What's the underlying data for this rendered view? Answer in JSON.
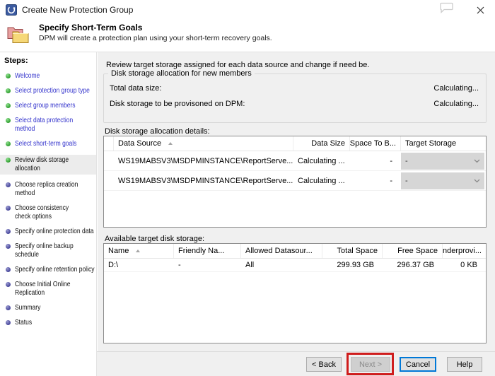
{
  "window": {
    "title": "Create New Protection Group"
  },
  "icons": {
    "titlebar": "dpm-app-icon",
    "feedback": "speech-bubble-icon",
    "close": "close-icon",
    "header": "protection-group-folders-icon",
    "sort": "sort-ascending-icon",
    "dropdown": "chevron-down-icon"
  },
  "header": {
    "title": "Specify Short-Term Goals",
    "subtitle": "DPM will create a protection plan using your short-term recovery goals."
  },
  "sidebar": {
    "heading": "Steps:",
    "steps": [
      {
        "label": "Welcome",
        "status": "done"
      },
      {
        "label": "Select protection group type",
        "status": "done"
      },
      {
        "label": "Select group members",
        "status": "done"
      },
      {
        "label": "Select data protection method",
        "status": "done"
      },
      {
        "label": "Select short-term goals",
        "status": "done"
      },
      {
        "label": "Review disk storage allocation",
        "status": "current"
      },
      {
        "label": "Choose replica creation method",
        "status": "upcoming"
      },
      {
        "label": "Choose consistency check options",
        "status": "upcoming"
      },
      {
        "label": "Specify online protection data",
        "status": "upcoming"
      },
      {
        "label": "Specify online backup schedule",
        "status": "upcoming"
      },
      {
        "label": "Specify online retention policy",
        "status": "upcoming"
      },
      {
        "label": "Choose Initial Online Replication",
        "status": "upcoming"
      },
      {
        "label": "Summary",
        "status": "upcoming"
      },
      {
        "label": "Status",
        "status": "upcoming"
      }
    ]
  },
  "main": {
    "intro": "Review target storage assigned for each data source and change if need be.",
    "allocation_box": {
      "title": "Disk storage allocation for new members",
      "rows": [
        {
          "label": "Total data size:",
          "value": "Calculating..."
        },
        {
          "label": "Disk storage to be provisoned on DPM:",
          "value": "Calculating..."
        }
      ]
    },
    "details_label": "Disk storage allocation details:",
    "details_table": {
      "columns": [
        "Data Source",
        "Data Size",
        "Space To B...",
        "Target Storage"
      ],
      "rows": [
        {
          "data_source": "WS19MABSV3\\MSDPMINSTANCE\\ReportServe...",
          "data_size": "Calculating ...",
          "space_to_b": "-",
          "target_storage": "-"
        },
        {
          "data_source": "WS19MABSV3\\MSDPMINSTANCE\\ReportServe...",
          "data_size": "Calculating ...",
          "space_to_b": "-",
          "target_storage": "-"
        }
      ]
    },
    "available_label": "Available target disk storage:",
    "available_table": {
      "columns": [
        "Name",
        "Friendly Na...",
        "Allowed Datasour...",
        "Total Space",
        "Free Space",
        "Underprovi..."
      ],
      "rows": [
        {
          "name": "D:\\",
          "friendly": "-",
          "allowed": "All",
          "total": "299.93 GB",
          "free": "296.37 GB",
          "under": "0 KB"
        }
      ]
    }
  },
  "footer": {
    "back_label": "< Back",
    "next_label": "Next >",
    "cancel_label": "Cancel",
    "help_label": "Help"
  },
  "colors": {
    "annotation_red": "#cf1d1d",
    "link_blue": "#3333cc",
    "done_bullet_green": "#2f9e2f",
    "upcoming_bullet_purple": "#45459a",
    "focus_border_blue": "#0078d7",
    "pane_gray": "#f0f0f0"
  }
}
